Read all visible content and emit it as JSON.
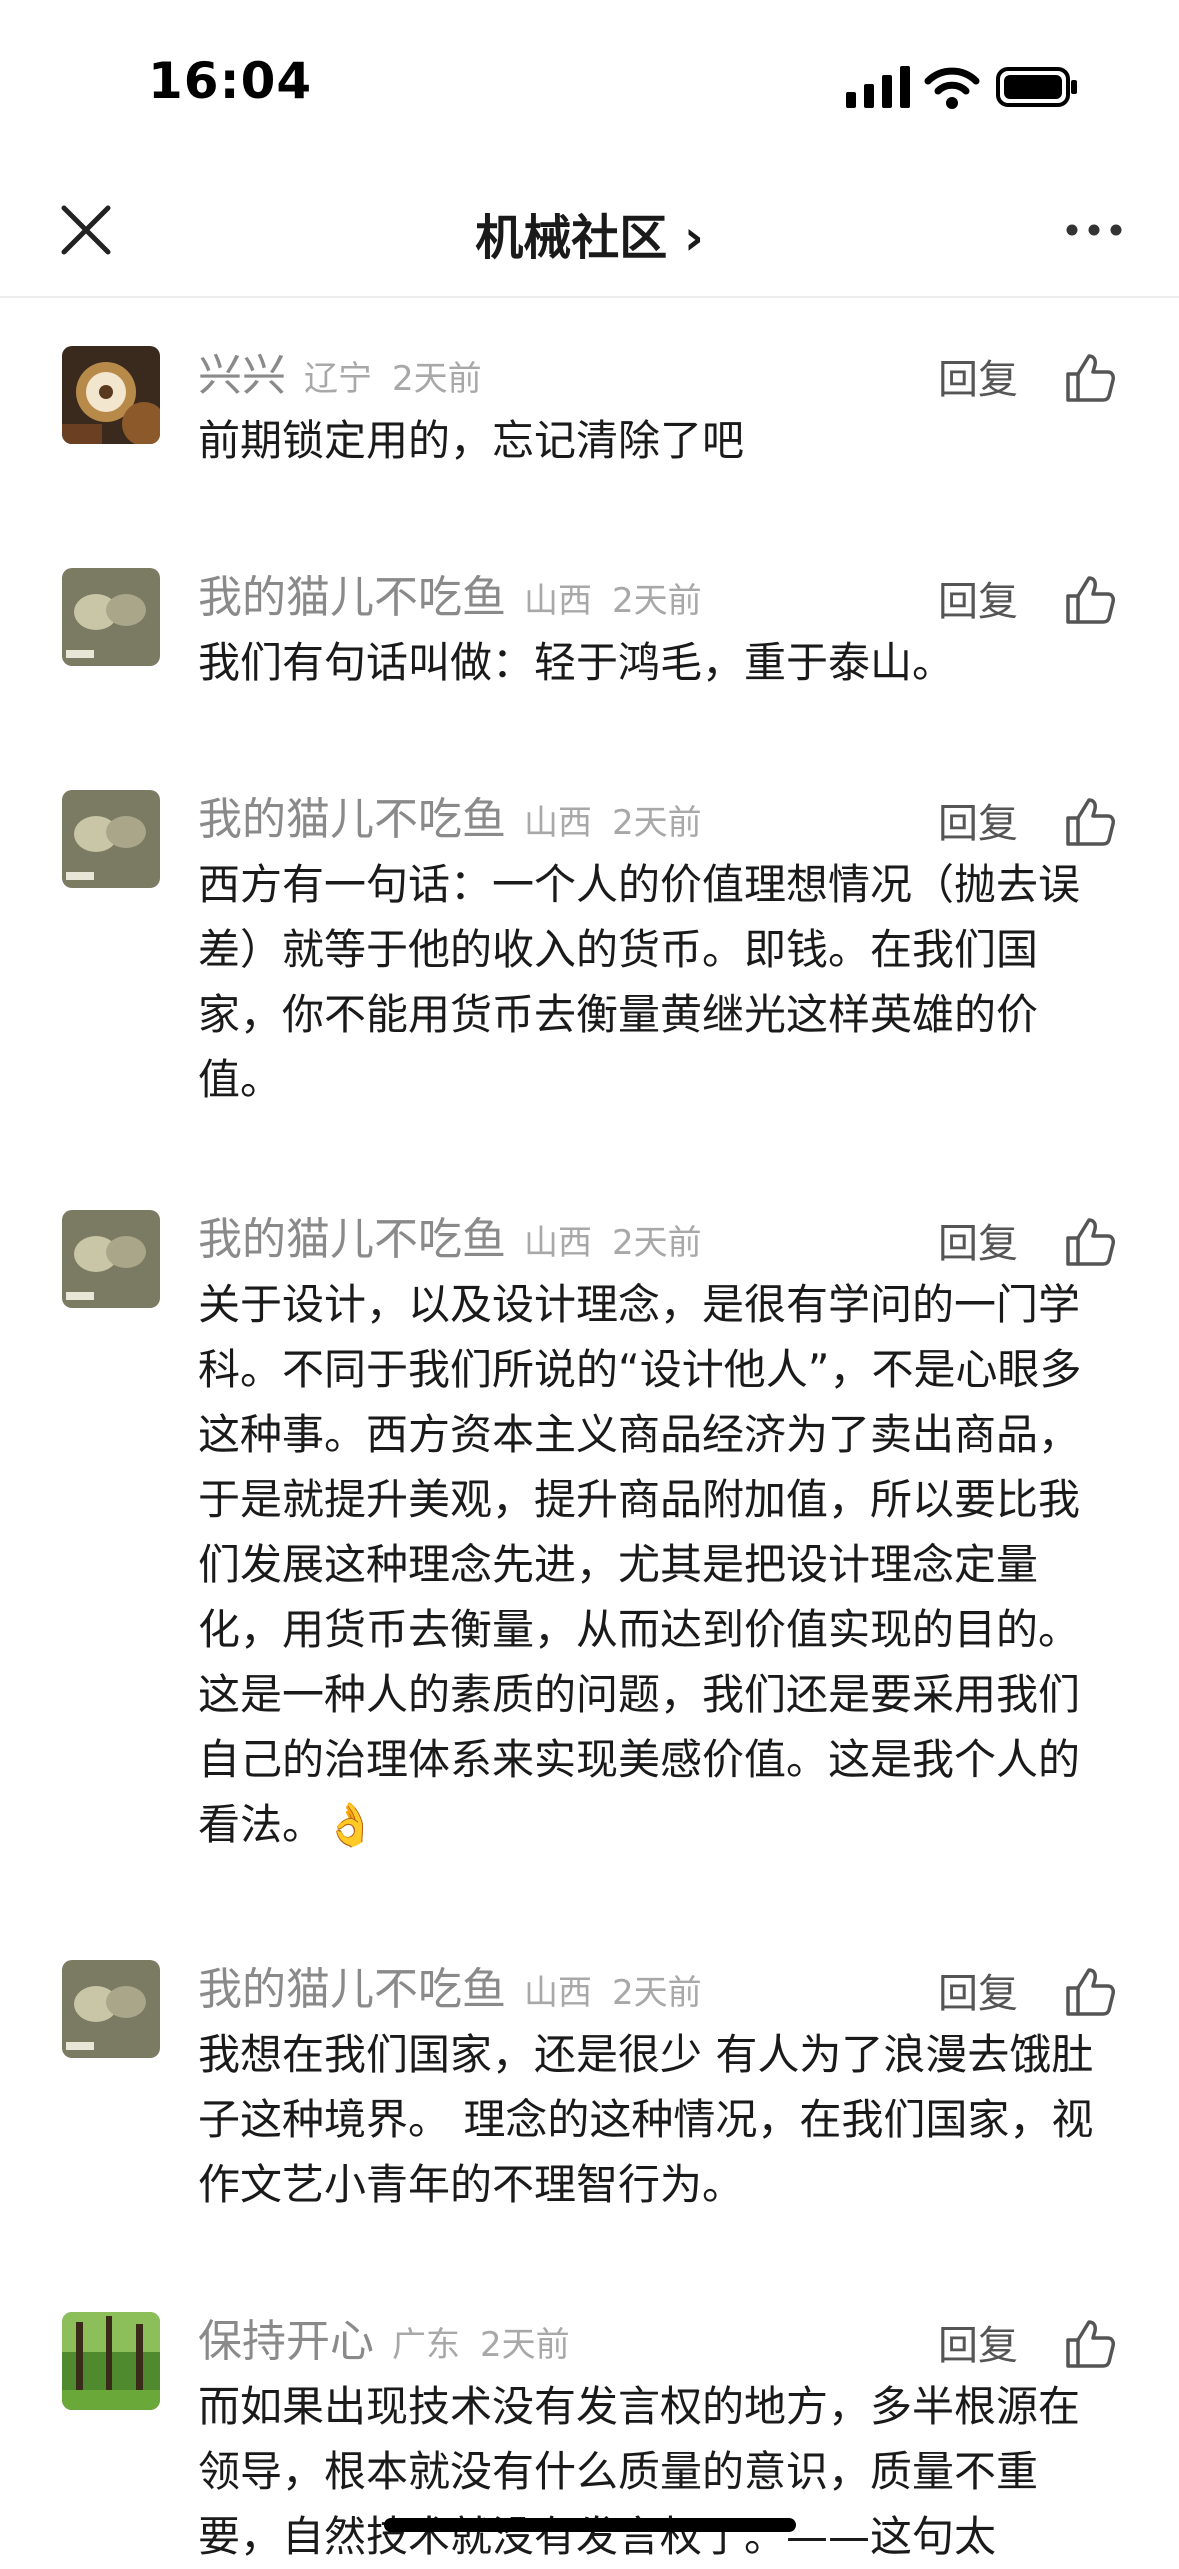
{
  "status_bar": {
    "time": "16:04"
  },
  "nav": {
    "title": "机械社区 ›"
  },
  "comments": [
    {
      "user": "兴兴",
      "region": "辽宁",
      "ago": "2天前",
      "reply": "回复",
      "text": "前期锁定用的，忘记清除了吧"
    },
    {
      "user": "我的猫儿不吃鱼",
      "region": "山西",
      "ago": "2天前",
      "reply": "回复",
      "text": "我们有句话叫做：轻于鸿毛，重于泰山。"
    },
    {
      "user": "我的猫儿不吃鱼",
      "region": "山西",
      "ago": "2天前",
      "reply": "回复",
      "text": "西方有一句话：一个人的价值理想情况（抛去误差）就等于他的收入的货币。即钱。在我们国家，你不能用货币去衡量黄继光这样英雄的价值。"
    },
    {
      "user": "我的猫儿不吃鱼",
      "region": "山西",
      "ago": "2天前",
      "reply": "回复",
      "text": "关于设计，以及设计理念，是很有学问的一门学科。不同于我们所说的“设计他人”，不是心眼多这种事。西方资本主义商品经济为了卖出商品，于是就提升美观，提升商品附加值，所以要比我们发展这种理念先进，尤其是把设计理念定量化，用货币去衡量，从而达到价值实现的目的。这是一种人的素质的问题，我们还是要采用我们自己的治理体系来实现美感价值。这是我个人的看法。👌"
    },
    {
      "user": "我的猫儿不吃鱼",
      "region": "山西",
      "ago": "2天前",
      "reply": "回复",
      "text": "我想在我们国家，还是很少  有人为了浪漫去饿肚子这种境界。  理念的这种情况，在我们国家，视作文艺小青年的不理智行为。"
    },
    {
      "user": "保持开心",
      "region": "广东",
      "ago": "2天前",
      "reply": "回复",
      "text": "而如果出现技术没有发言权的地方，多半根源在领导，根本就没有什么质量的意识，质量不重要，自然技术就没有发言权了。——这句太"
    }
  ]
}
